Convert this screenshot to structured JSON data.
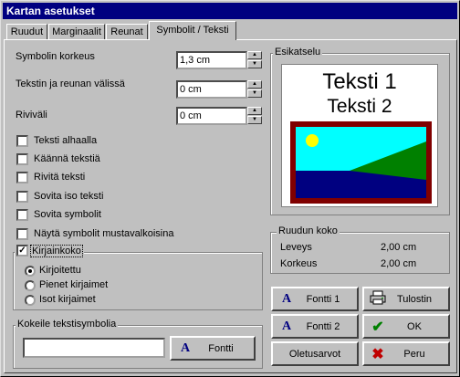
{
  "window": {
    "title": "Kartan asetukset"
  },
  "tabs": [
    {
      "label": "Ruudut"
    },
    {
      "label": "Marginaalit"
    },
    {
      "label": "Reunat"
    },
    {
      "label": "Symbolit / Teksti"
    }
  ],
  "fields": {
    "symbol_height": {
      "label": "Symbolin korkeus",
      "value": "1,3 cm"
    },
    "text_border_gap": {
      "label": "Tekstin ja reunan välissä",
      "value": "0 cm"
    },
    "line_spacing": {
      "label": "Riviväli",
      "value": "0 cm"
    }
  },
  "checkboxes": [
    {
      "label": "Teksti alhaalla",
      "checked": false
    },
    {
      "label": "Käännä tekstiä",
      "checked": false
    },
    {
      "label": "Rivitä teksti",
      "checked": false
    },
    {
      "label": "Sovita iso teksti",
      "checked": false
    },
    {
      "label": "Sovita symbolit",
      "checked": false
    },
    {
      "label": "Näytä symbolit mustavalkoisina",
      "checked": false
    }
  ],
  "case_group": {
    "checkbox_label": "Kirjainkoko",
    "checked": true,
    "mark": "✓",
    "options": [
      {
        "label": "Kirjoitettu",
        "selected": true
      },
      {
        "label": "Pienet kirjaimet",
        "selected": false
      },
      {
        "label": "Isot kirjaimet",
        "selected": false
      }
    ]
  },
  "try_group": {
    "title": "Kokeile tekstisymbolia",
    "input_value": "",
    "font_button": "Fontti"
  },
  "preview": {
    "title": "Esikatselu",
    "text1": "Teksti 1",
    "text2": "Teksti 2",
    "colors": {
      "frame": "#800000",
      "sky": "#00ffff",
      "sea": "#000080",
      "land": "#008000",
      "sun": "#ffff00"
    }
  },
  "cell_size": {
    "title": "Ruudun koko",
    "width_label": "Leveys",
    "width_value": "2,00 cm",
    "height_label": "Korkeus",
    "height_value": "2,00 cm"
  },
  "buttons": {
    "font1": "Fontti 1",
    "print": "Tulostin",
    "font2": "Fontti 2",
    "ok": "OK",
    "defaults": "Oletusarvot",
    "cancel": "Peru"
  },
  "icons": {
    "font": "A",
    "ok": "✔",
    "cancel": "✖"
  }
}
